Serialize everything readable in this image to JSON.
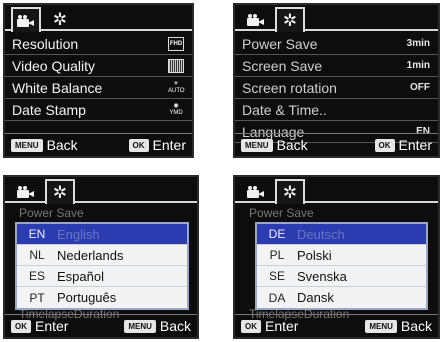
{
  "screen1": {
    "items": [
      {
        "label": "Resolution",
        "value": "FHD"
      },
      {
        "label": "Video Quality",
        "value": ""
      },
      {
        "label": "White Balance",
        "value": "AUTO"
      },
      {
        "label": "Date Stamp",
        "value": "YMD"
      }
    ],
    "footer_left_key": "MENU",
    "footer_left_label": "Back",
    "footer_right_key": "OK",
    "footer_right_label": "Enter"
  },
  "screen2": {
    "items": [
      {
        "label": "Power Save",
        "value": "3min"
      },
      {
        "label": "Screen Save",
        "value": "1min"
      },
      {
        "label": "Screen rotation",
        "value": "OFF"
      },
      {
        "label": "Date & Time..",
        "value": ""
      },
      {
        "label": "Language",
        "value": "EN"
      }
    ],
    "footer_left_key": "MENU",
    "footer_left_label": "Back",
    "footer_right_key": "OK",
    "footer_right_label": "Enter"
  },
  "screen3": {
    "background_top": "Power Save",
    "background_bottom": "TimelapseDuration",
    "languages": [
      {
        "code": "EN",
        "name": "English"
      },
      {
        "code": "NL",
        "name": "Nederlands"
      },
      {
        "code": "ES",
        "name": "Español"
      },
      {
        "code": "PT",
        "name": "Português"
      }
    ],
    "footer_left_key": "OK",
    "footer_left_label": "Enter",
    "footer_right_key": "MENU",
    "footer_right_label": "Back"
  },
  "screen4": {
    "background_top": "Power Save",
    "background_bottom": "TimelapseDuration",
    "languages": [
      {
        "code": "DE",
        "name": "Deutsch"
      },
      {
        "code": "PL",
        "name": "Polski"
      },
      {
        "code": "SE",
        "name": "Svenska"
      },
      {
        "code": "DA",
        "name": "Dansk"
      }
    ],
    "footer_left_key": "OK",
    "footer_left_label": "Enter",
    "footer_right_key": "MENU",
    "footer_right_label": "Back"
  },
  "icons": {
    "tab_video": "camera-icon",
    "tab_settings": "gear-icon"
  },
  "colors": {
    "screen_bg": "#0d0d0d",
    "selection": "#2b3cb0",
    "popup_bg": "#f3f3f3"
  }
}
